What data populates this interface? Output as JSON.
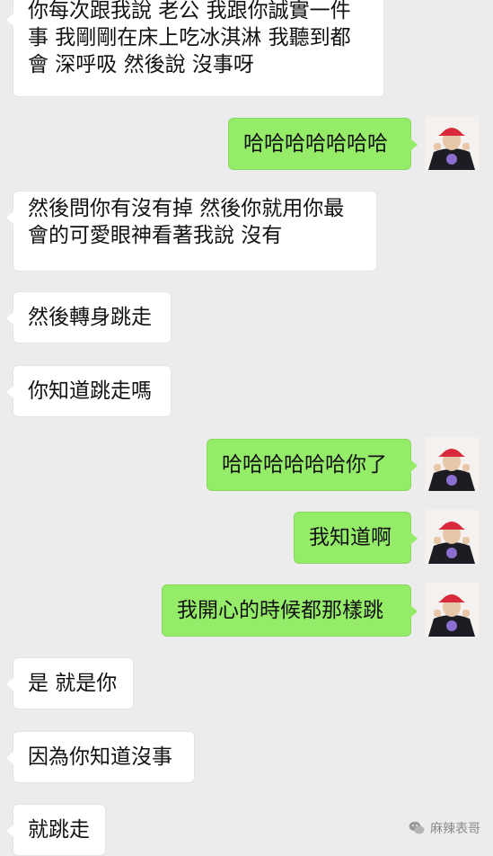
{
  "messages": [
    {
      "side": "in",
      "text": "你每次跟我說 老公 我跟你誠實一件事 我剛剛在床上吃冰淇淋 我聽到都會 深呼吸 然後說 沒事呀"
    },
    {
      "side": "out",
      "text": "哈哈哈哈哈哈哈"
    },
    {
      "side": "in",
      "text": "然後問你有沒有掉 然後你就用你最會的可愛眼神看著我說 沒有"
    },
    {
      "side": "in",
      "text": "然後轉身跳走"
    },
    {
      "side": "in",
      "text": "你知道跳走嗎"
    },
    {
      "side": "out",
      "text": "哈哈哈哈哈哈你了"
    },
    {
      "side": "out",
      "text": "我知道啊"
    },
    {
      "side": "out",
      "text": "我開心的時候都那樣跳"
    },
    {
      "side": "in",
      "text": "是 就是你"
    },
    {
      "side": "in",
      "text": "因為你知道沒事"
    },
    {
      "side": "in",
      "text": "就跳走"
    }
  ],
  "watermark": {
    "text": "麻辣表哥",
    "icon": "wechat-icon"
  },
  "colors": {
    "background": "#ececec",
    "incoming": "#ffffff",
    "outgoing": "#95ec69"
  }
}
